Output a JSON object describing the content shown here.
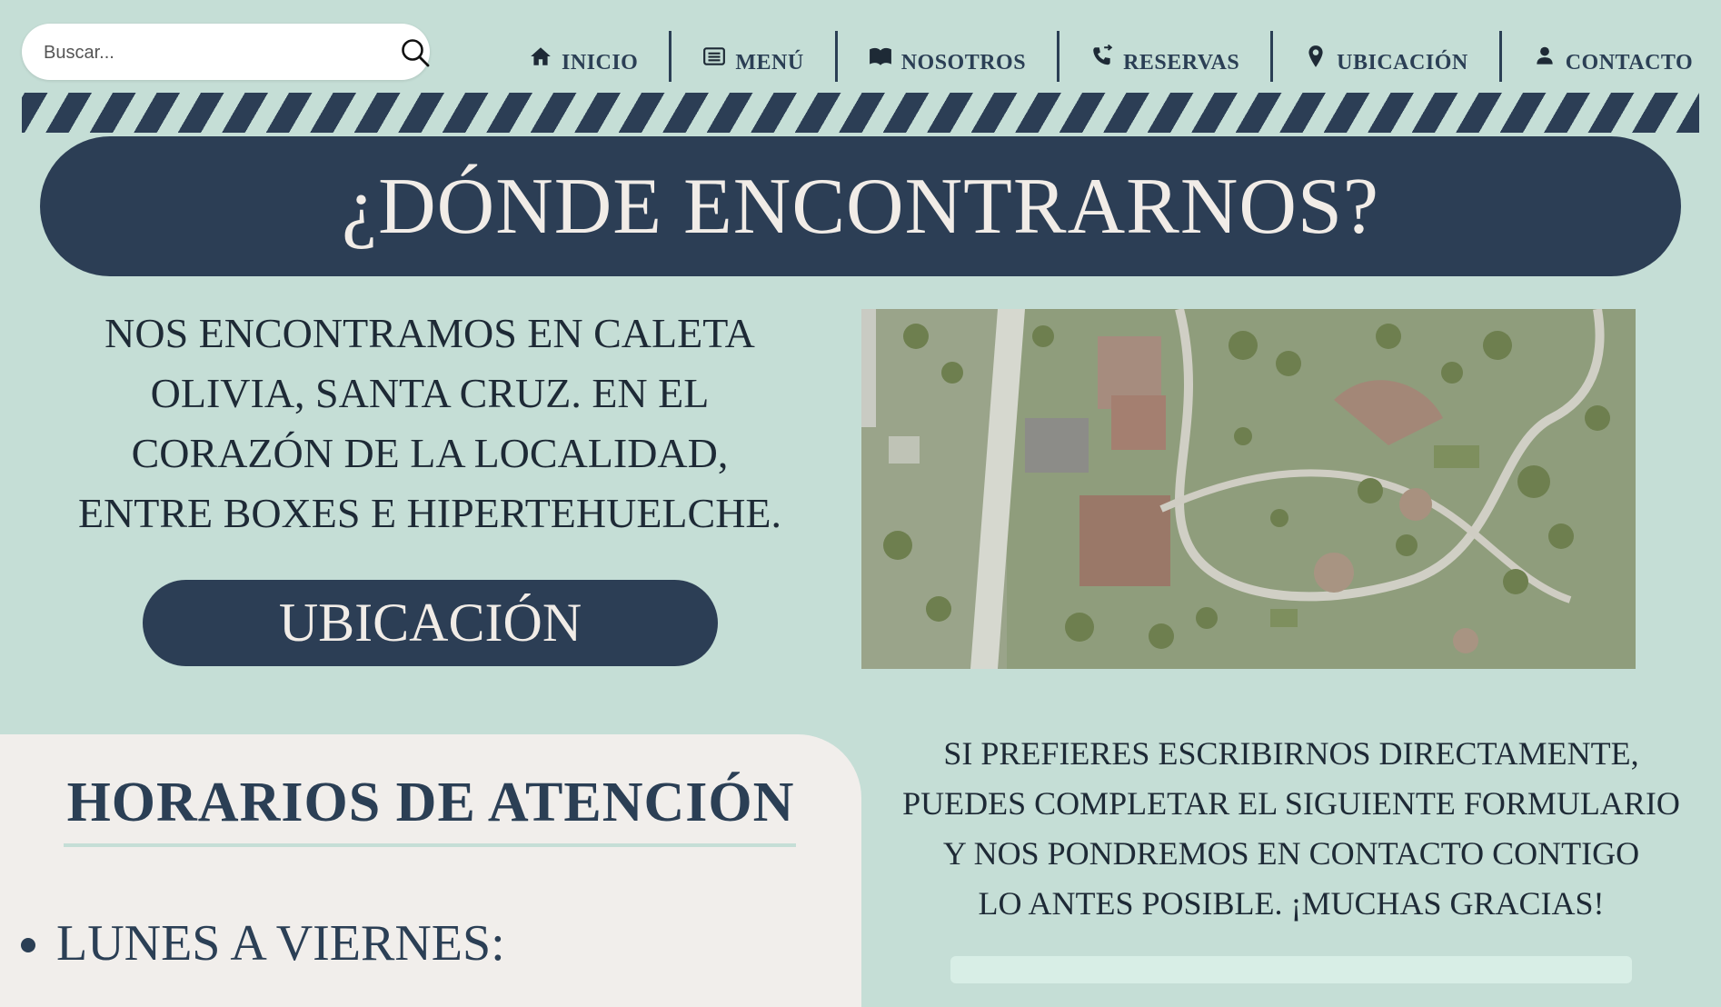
{
  "search": {
    "placeholder": "Buscar...",
    "icon": "search-icon"
  },
  "nav": {
    "items": [
      {
        "label": "INICIO",
        "icon": "home-icon"
      },
      {
        "label": "MENÚ",
        "icon": "list-icon"
      },
      {
        "label": "NOSOTROS",
        "icon": "book-icon"
      },
      {
        "label": "RESERVAS",
        "icon": "phone-icon"
      },
      {
        "label": "UBICACIÓN",
        "icon": "map-pin-icon"
      },
      {
        "label": "CONTACTO",
        "icon": "user-icon"
      }
    ]
  },
  "banner": {
    "title": "¿DÓNDE ENCONTRARNOS?"
  },
  "location": {
    "lines": [
      "NOS ENCONTRAMOS EN CALETA",
      "OLIVIA, SANTA CRUZ. EN EL",
      "CORAZÓN DE LA LOCALIDAD,",
      "ENTRE BOXES E HIPERTEHUELCHE."
    ],
    "button_label": "UBICACIÓN"
  },
  "hours": {
    "title": "HORARIOS DE ATENCIÓN",
    "items": [
      "LUNES A VIERNES:"
    ]
  },
  "contact": {
    "lines": [
      "SI PREFIERES ESCRIBIRNOS DIRECTAMENTE,",
      "PUEDES COMPLETAR EL SIGUIENTE FORMULARIO",
      "Y NOS PONDREMOS EN CONTACTO CONTIGO",
      "LO ANTES POSIBLE. ¡MUCHAS GRACIAS!"
    ]
  },
  "colors": {
    "background": "#c5ded6",
    "navy": "#2c3e55",
    "cream": "#f1eeeb",
    "banner_text": "#f1ece7"
  }
}
